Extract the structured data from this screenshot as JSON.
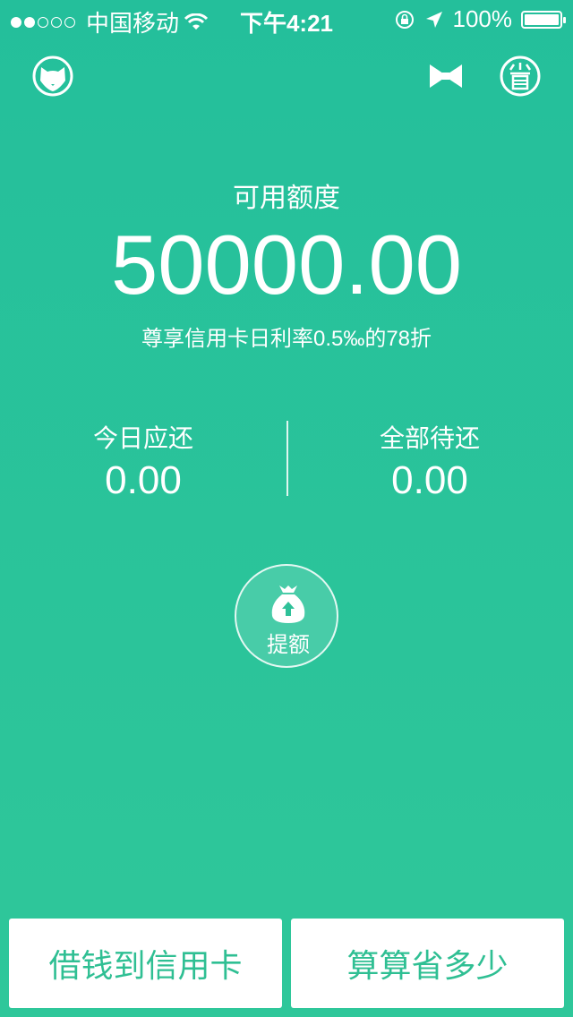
{
  "status_bar": {
    "carrier": "中国移动",
    "time": "下午4:21",
    "battery_percent": "100%",
    "battery_level": 1.0,
    "signal_bars_filled": 2,
    "signal_bars_total": 5
  },
  "header": {
    "left_icon": "cat-avatar-icon",
    "middle_icon": "bowtie-icon",
    "right_icon": "save-icon"
  },
  "credit": {
    "label": "可用额度",
    "amount": "50000.00",
    "subtitle": "尊享信用卡日利率0.5‰的78折"
  },
  "repayment": {
    "today_label": "今日应还",
    "today_value": "0.00",
    "all_label": "全部待还",
    "all_value": "0.00"
  },
  "raise_limit": {
    "label": "提额",
    "icon": "money-bag-up-icon"
  },
  "actions": {
    "borrow_label": "借钱到信用卡",
    "calc_label": "算算省多少"
  },
  "colors": {
    "background_top": "#24bf9b",
    "background_bottom": "#2fc79a",
    "accent_text": "#2fbf93",
    "button_bg": "#ffffff"
  }
}
